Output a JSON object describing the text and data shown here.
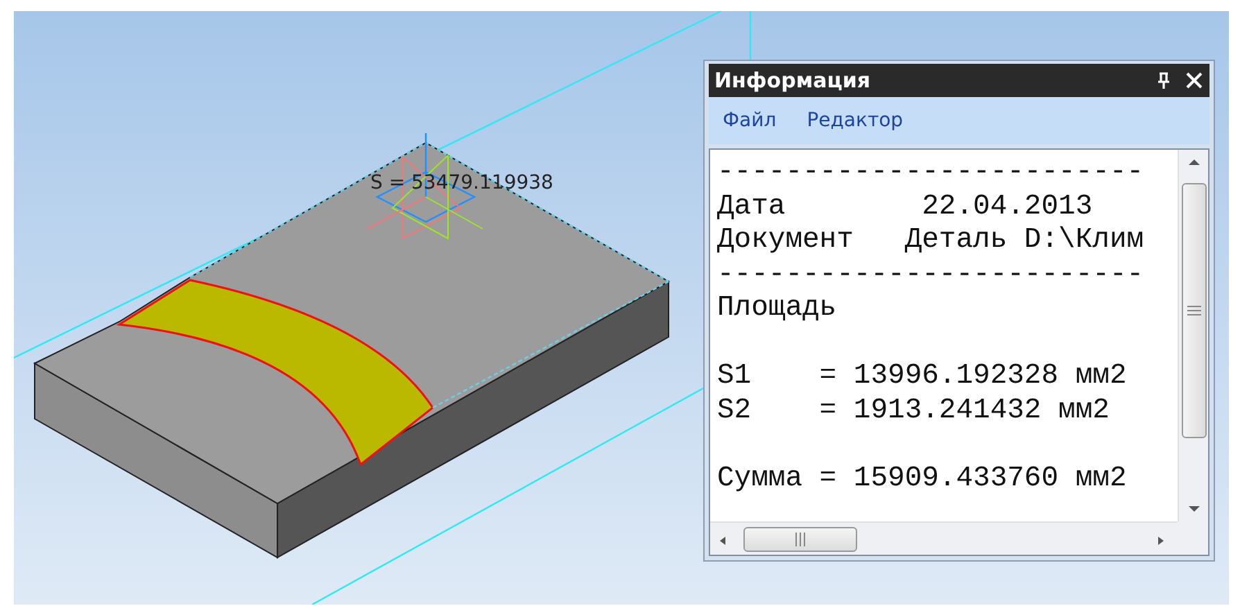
{
  "viewport": {
    "label": "S = 53479.119938"
  },
  "info_window": {
    "title": "Информация",
    "menu": [
      "Файл",
      "Редактор"
    ],
    "lines": [
      {
        "kind": "text",
        "text": "-------------------------"
      },
      {
        "kind": "text",
        "text": "Дата        22.04.2013"
      },
      {
        "kind": "text",
        "text": "Документ   Деталь D:\\Клим"
      },
      {
        "kind": "text",
        "text": "-------------------------"
      },
      {
        "kind": "text",
        "text": "Площадь"
      },
      {
        "kind": "gap"
      },
      {
        "kind": "text",
        "text": "S1    = 13996.192328 мм2"
      },
      {
        "kind": "text",
        "text": "S2    = 1913.241432 мм2"
      },
      {
        "kind": "gap"
      },
      {
        "kind": "text",
        "text": "Сумма = 15909.433760 мм2"
      }
    ]
  }
}
